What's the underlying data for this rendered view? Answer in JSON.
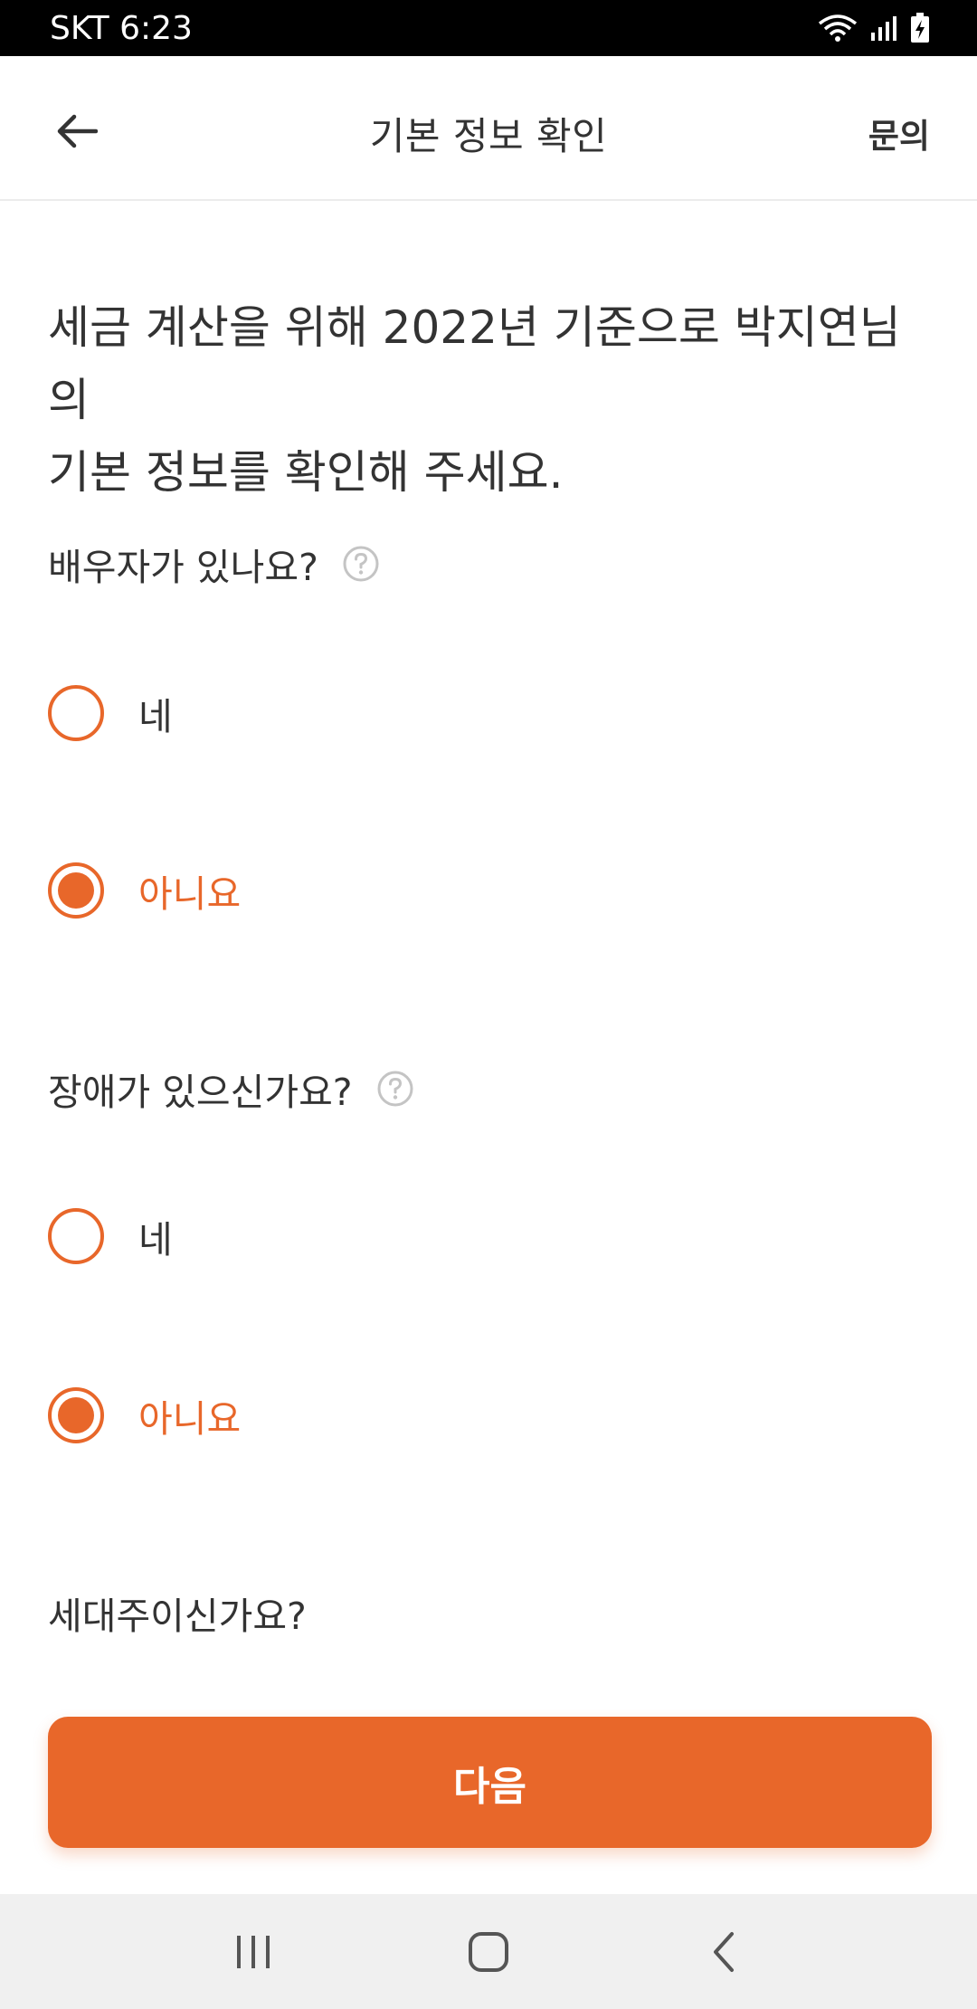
{
  "status_bar": {
    "carrier_time": "SKT 6:23"
  },
  "header": {
    "title": "기본 정보 확인",
    "inquiry_label": "문의"
  },
  "intro": {
    "line1": "세금 계산을 위해 2022년 기준으로 박지연님의",
    "line2": "기본 정보를 확인해 주세요."
  },
  "questions": [
    {
      "label": "배우자가 있나요?",
      "has_help": true,
      "options": [
        {
          "label": "네",
          "selected": false
        },
        {
          "label": "아니요",
          "selected": true
        }
      ]
    },
    {
      "label": "장애가 있으신가요?",
      "has_help": true,
      "options": [
        {
          "label": "네",
          "selected": false
        },
        {
          "label": "아니요",
          "selected": true
        }
      ]
    },
    {
      "label": "세대주이신가요?",
      "has_help": false
    }
  ],
  "next_button": {
    "label": "다음"
  },
  "colors": {
    "accent": "#e8672a",
    "text": "#333333"
  },
  "icons": {
    "back": "arrow-left-icon",
    "help": "question-circle-icon",
    "nav": [
      "recent-apps-icon",
      "home-icon",
      "back-chevron-icon"
    ]
  }
}
